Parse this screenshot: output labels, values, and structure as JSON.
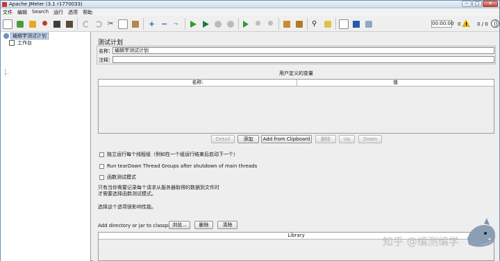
{
  "window": {
    "title": "Apache JMeter (3.1 r1770033)",
    "controls": [
      "−",
      "□",
      "✕"
    ]
  },
  "menu": [
    "文件",
    "编辑",
    "Search",
    "运行",
    "选项",
    "帮助"
  ],
  "toolbar": {
    "timer": "00:00:00",
    "warning_count": "0",
    "threads": "0 / 0",
    "icons": [
      "new-icon",
      "templates-icon",
      "open-icon",
      "close-icon",
      "save-icon",
      "save-as-icon",
      "undo-icon",
      "redo-icon",
      "cut-icon",
      "copy-icon",
      "paste-icon",
      "expand-icon",
      "collapse-icon",
      "toggle-icon",
      "start-icon",
      "start-no-pause-icon",
      "stop-icon",
      "shutdown-icon",
      "remote-start-icon",
      "remote-stop-icon",
      "remote-shutdown-icon",
      "clear-icon",
      "clear-all-icon",
      "search-icon",
      "reset-search-icon",
      "function-helper-icon",
      "help-icon",
      "remote-icon"
    ]
  },
  "tree": {
    "root": "编辑学测试计划",
    "child": "工作台"
  },
  "panel": {
    "title": "测试计划",
    "name_label": "名称：",
    "name_value": "编辑学测试计划",
    "comment_label": "注释：",
    "comment_value": "",
    "vars_title": "用户定义的变量",
    "vars_columns": [
      "名称:",
      "值"
    ],
    "buttons": [
      "Detail",
      "添加",
      "Add from Clipboard",
      "删除",
      "Up",
      "Down"
    ],
    "checkboxes": [
      "独立运行每个线程组（例如在一个组运行结束后启动下一个）",
      "Run tearDown Thread Groups after shutdown of main threads",
      "函数测试模式"
    ],
    "notes": [
      "只有当你需要记录每个请求从服务器取得的数据到文件时",
      "才需要选择函数测试模式。",
      "选择这个选项很影响性能。"
    ],
    "classpath_label": "Add directory or jar to classpath",
    "classpath_buttons": [
      "浏览...",
      "删除",
      "清除"
    ],
    "library_header": "Library"
  },
  "watermark": "知乎 @编测编学"
}
